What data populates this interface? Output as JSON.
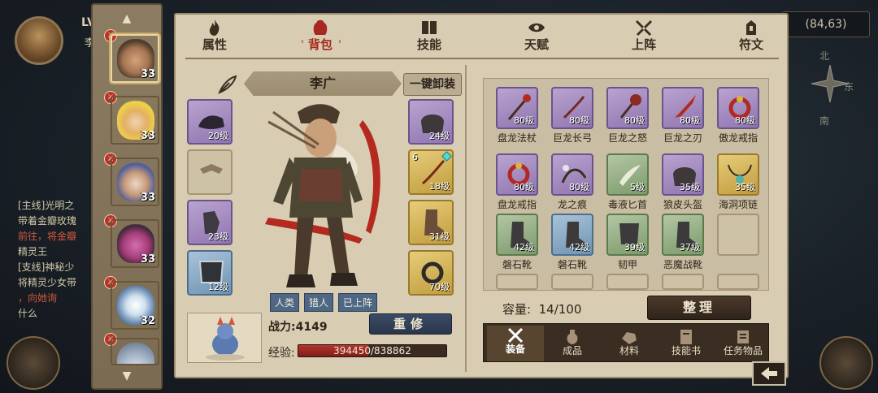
{
  "background": {
    "player_lv": "LV",
    "player_name_char": "李",
    "coordinates": "(84,63)",
    "compass": {
      "north": "北",
      "east": "东",
      "south": "南"
    },
    "quests": [
      {
        "label": "[主线]光明之"
      },
      {
        "label": "带着金瓣玫瑰"
      },
      {
        "label": "前往，将金瓣",
        "highlight": true
      },
      {
        "label": "精灵王"
      },
      {
        "label": "[支线]神秘少"
      },
      {
        "label": "将精灵少女带"
      },
      {
        "label": "，向她询"
      },
      {
        "label": "什么"
      }
    ]
  },
  "roster": {
    "heroes": [
      {
        "level": "33",
        "active": true
      },
      {
        "level": "33"
      },
      {
        "level": "33"
      },
      {
        "level": "33"
      },
      {
        "level": "32"
      },
      {
        "level": ""
      }
    ]
  },
  "tabs": [
    {
      "label": "属性",
      "icon": "flame-icon"
    },
    {
      "label": "背包",
      "icon": "bag-icon",
      "active": true
    },
    {
      "label": "技能",
      "icon": "book-icon"
    },
    {
      "label": "天赋",
      "icon": "eye-icon"
    },
    {
      "label": "上阵",
      "icon": "crossed-swords-icon"
    },
    {
      "label": "符文",
      "icon": "rune-icon"
    }
  ],
  "hero": {
    "name": "李广",
    "unequip_all": "一键卸装",
    "tags": [
      "人类",
      "猎人",
      "已上阵"
    ],
    "power_label": "战力:",
    "power_value": "4149",
    "rebuild": "重修",
    "exp_label": "经验:",
    "exp_current": "394450",
    "exp_max": "838862",
    "exp_ratio": 0.47
  },
  "equip_left": [
    {
      "level": "20级",
      "rarity": "purple",
      "icon": "hat-icon"
    },
    {
      "level": "",
      "rarity": "empty",
      "icon": "amulet-slot-icon"
    },
    {
      "level": "23级",
      "rarity": "purple",
      "icon": "gauntlet-icon"
    },
    {
      "level": "12级",
      "rarity": "blue",
      "icon": "armor-icon"
    }
  ],
  "equip_right": [
    {
      "level": "24级",
      "rarity": "purple",
      "icon": "helmet-icon"
    },
    {
      "level": "18级",
      "rarity": "gold",
      "icon": "bow-icon",
      "plus": "6"
    },
    {
      "level": "31级",
      "rarity": "gold",
      "icon": "boots-icon"
    },
    {
      "level": "70级",
      "rarity": "gold",
      "icon": "ring-icon"
    }
  ],
  "inventory": {
    "items": [
      {
        "name": "盘龙法杖",
        "level": "80级",
        "rarity": "purple",
        "icon": "staff-icon"
      },
      {
        "name": "巨龙长弓",
        "level": "80级",
        "rarity": "purple",
        "icon": "bow-icon"
      },
      {
        "name": "巨龙之怒",
        "level": "80级",
        "rarity": "purple",
        "icon": "mace-icon"
      },
      {
        "name": "巨龙之刃",
        "level": "80级",
        "rarity": "purple",
        "icon": "blade-icon"
      },
      {
        "name": "傲龙戒指",
        "level": "80级",
        "rarity": "purple",
        "icon": "ring-icon"
      },
      {
        "name": "盘龙戒指",
        "level": "80级",
        "rarity": "purple",
        "icon": "ring-icon"
      },
      {
        "name": "龙之痕",
        "level": "80级",
        "rarity": "purple",
        "icon": "whip-icon"
      },
      {
        "name": "毒液匕首",
        "level": "5级",
        "rarity": "green",
        "icon": "dagger-icon"
      },
      {
        "name": "狼皮头盔",
        "level": "35级",
        "rarity": "purple",
        "icon": "helmet-icon"
      },
      {
        "name": "海洞项链",
        "level": "35级",
        "rarity": "gold",
        "icon": "necklace-icon"
      },
      {
        "name": "磐石靴",
        "level": "42级",
        "rarity": "green",
        "icon": "boots-icon"
      },
      {
        "name": "磐石靴",
        "level": "42级",
        "rarity": "blue",
        "icon": "boots-icon"
      },
      {
        "name": "韧甲",
        "level": "39级",
        "rarity": "green",
        "icon": "armor-icon"
      },
      {
        "name": "恶魔战靴",
        "level": "37级",
        "rarity": "green",
        "icon": "boots-icon"
      },
      {
        "name": "",
        "level": "",
        "rarity": "empty",
        "icon": ""
      }
    ],
    "capacity_label": "容量:",
    "capacity_value": "14/100",
    "sort": "整理",
    "tabs": [
      {
        "label": "装备",
        "icon": "equipment-icon",
        "active": true
      },
      {
        "label": "成品",
        "icon": "potion-icon"
      },
      {
        "label": "材料",
        "icon": "ore-icon"
      },
      {
        "label": "技能书",
        "icon": "scroll-icon"
      },
      {
        "label": "任务物品",
        "icon": "quest-scroll-icon"
      }
    ]
  },
  "colors": {
    "panel_bg": "#d8ccb2",
    "accent_red": "#a6281e",
    "purple_item": "#8f76b1",
    "gold_item": "#c19c3c",
    "blue_item": "#6f93b3",
    "green_item": "#7c9a6b"
  }
}
